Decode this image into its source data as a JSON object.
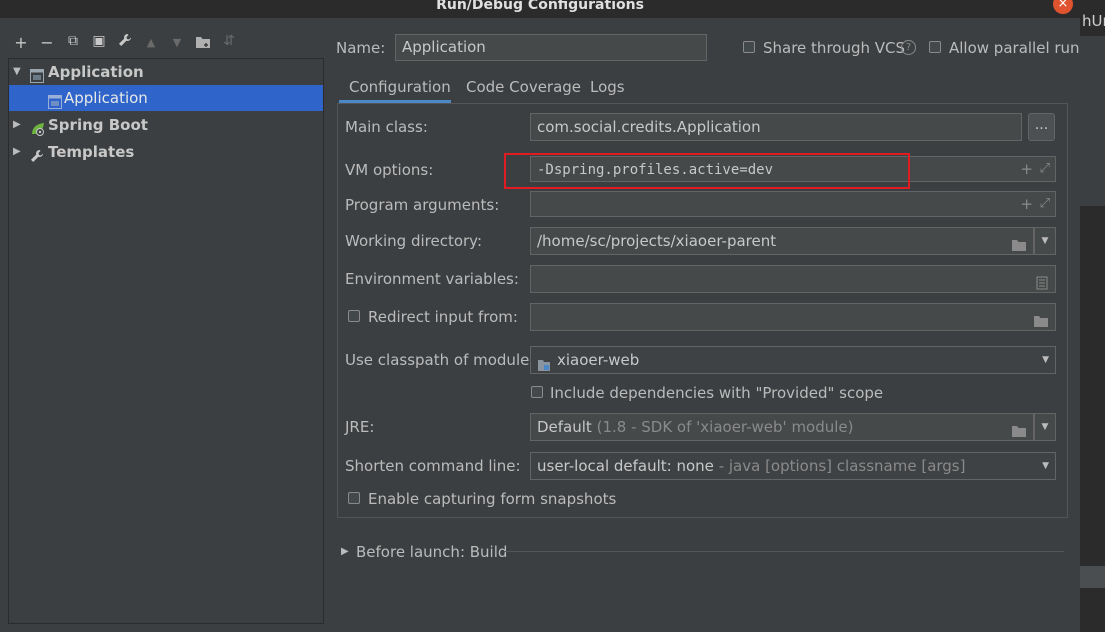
{
  "window": {
    "title": "Run/Debug Configurations",
    "close_icon": "×"
  },
  "background": {
    "partial_text": "hUr"
  },
  "toolbar": {
    "icons": [
      "add-icon",
      "remove-icon",
      "copy-icon",
      "save-icon",
      "wrench-icon",
      "move-up-icon",
      "move-down-icon",
      "folder-icon",
      "sort-icon"
    ],
    "glyphs": {
      "add": "+",
      "remove": "−",
      "copy": "⧉",
      "save": "▣",
      "wrench": "🔧",
      "up": "▲",
      "down": "▼",
      "folder": "▤",
      "sort": "⇵"
    }
  },
  "tree": {
    "items": [
      {
        "label": "Application",
        "bold": true,
        "expanded": true
      },
      {
        "label": "Application",
        "selected": true
      },
      {
        "label": "Spring Boot",
        "bold": true
      },
      {
        "label": "Templates",
        "bold": true
      }
    ]
  },
  "header": {
    "name_label": "Name:",
    "name_value": "Application",
    "share_label": "Share through VCS",
    "help_icon": "?",
    "parallel_label": "Allow parallel run"
  },
  "tabs": [
    "Configuration",
    "Code Coverage",
    "Logs"
  ],
  "form": {
    "main_class_label": "Main class:",
    "main_class_value": "com.social.credits.Application",
    "browse_button": "...",
    "vm_options_label": "VM options:",
    "vm_options_value": "-Dspring.profiles.active=dev",
    "program_args_label": "Program arguments:",
    "program_args_value": "",
    "working_dir_label": "Working directory:",
    "working_dir_value": "/home/sc/projects/xiaoer-parent",
    "env_vars_label": "Environment variables:",
    "env_vars_value": "",
    "redirect_label": "Redirect input from:",
    "redirect_value": "",
    "classpath_label": "Use classpath of module:",
    "classpath_value": "xiaoer-web",
    "include_deps_label": "Include dependencies with \"Provided\" scope",
    "jre_label": "JRE:",
    "jre_value": "Default",
    "jre_hint": "(1.8 - SDK of 'xiaoer-web' module)",
    "shorten_label": "Shorten command line:",
    "shorten_value": "user-local default: none",
    "shorten_hint": "- java [options] classname [args]",
    "snapshots_label": "Enable capturing form snapshots",
    "plus_icon": "+",
    "expand_icon": "⤢",
    "dropdown_icon": "▼"
  },
  "before_launch": {
    "label": "Before launch: Build",
    "arrow": "▶"
  },
  "colors": {
    "accent": "#2f65ca",
    "tab_underline": "#4a88c7",
    "highlight_box": "#e11b22",
    "close": "#e0532f"
  }
}
